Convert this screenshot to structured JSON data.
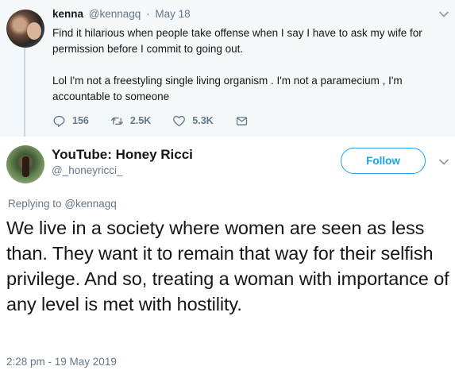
{
  "parent_tweet": {
    "name": "kenna",
    "handle": "@kennagq",
    "separator": "·",
    "date": "May 18",
    "paragraphs": [
      "Find it hilarious when people take offense when I say I have to ask my wife for permission before I commit to going out.",
      "Lol I'm not a freestyling single living organism . I'm not a paramecium , I'm accountable to someone"
    ],
    "actions": {
      "replies": "156",
      "retweets": "2.5K",
      "likes": "5.3K"
    }
  },
  "main_tweet": {
    "name": "YouTube: Honey Ricci",
    "handle": "@_honeyricci_",
    "follow_label": "Follow",
    "replying_prefix": "Replying to",
    "replying_handle": "@kennagq",
    "text": "We live in a society where women are seen as less than. They want it to remain that way for their selfish privilege. And so, treating a woman with importance of any level is met with hostility.",
    "timestamp": "2:28 pm - 19 May 2019"
  },
  "colors": {
    "accent": "#1da1f2",
    "secondary_text": "#657786",
    "parent_background": "#f5f8fa"
  },
  "icons": [
    "chevron-down-icon",
    "reply-icon",
    "retweet-icon",
    "like-icon",
    "message-icon"
  ]
}
